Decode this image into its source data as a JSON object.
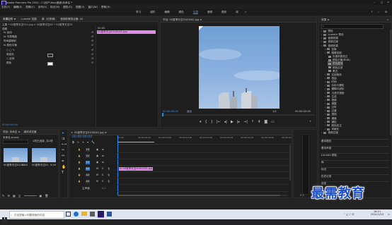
{
  "window": {
    "title": "Adobe Premiere Pro 2020 - C:\\用户\\Hao\\桌面\\未命名 *",
    "menu": [
      "文件(F)",
      "编辑(E)",
      "剪辑(C)",
      "序列(S)",
      "标记(M)",
      "图形(G)",
      "视图(V)",
      "窗口(W)",
      "帮助(H)"
    ]
  },
  "workspaces": {
    "tabs": [
      "学习",
      "组件",
      "编辑",
      "颜色",
      "效果",
      "音频",
      "图形",
      "库"
    ],
    "active_index": 4
  },
  "effect_controls": {
    "tabs": [
      "效果控件 ≡",
      "Lumetri 范围",
      "源: (无剪辑)",
      "音频剪辑混合器: 00"
    ],
    "source_line": "主要 * 00夏季天空011.jpg ∨   00夏季天空01 * 00夏季天空01",
    "video_header": "视频",
    "clip_time": "00:00",
    "clip_name": "00夏季天空0100042.jpg",
    "rows": [
      "fx 运动",
      "fx 不透明度",
      "时间重映射",
      "fx 颜色平衡",
      "○ □ ✎",
      "渐变色",
      "○ 反转",
      "颜色"
    ],
    "timecode": "00:00:00:00"
  },
  "program_monitor": {
    "title": "节目: 00夏季天空0100042.jpg ≡",
    "timecode_left": "00:00:00:00",
    "fit_label": "适合",
    "quality": "1/2",
    "timecode_right": "00:00:02:00"
  },
  "project": {
    "tabs": [
      "项目: 未命名 ≡",
      "媒体浏览器"
    ],
    "file_label": "未命名.prproj",
    "items_count": "1项已选择, 共2项",
    "thumbs": [
      {
        "name": "00夏季天空01002",
        "duration": "5:00"
      },
      {
        "name": "00夏季天空01",
        "duration": "5:00"
      }
    ]
  },
  "timeline": {
    "title": "00夏季天空0100042.jpg ≡",
    "timecode": "00:00:00:00",
    "ruler": [
      "00:00",
      "00:00:05:00",
      "00:00:10:00",
      "00:00:15:00",
      "00:00:20:00",
      "00:00:25:00",
      "00:00:30:00",
      "00:00:35:00",
      "00:00:40:00"
    ],
    "tracks": [
      "V3",
      "V2",
      "V1",
      "A1",
      "A2",
      "A3",
      "主声道"
    ],
    "master_value": "0.0",
    "clip_label": "fx 00夏季天空0100042.jpg"
  },
  "effects_panel": {
    "title": "效果 ≡",
    "items": [
      {
        "label": "预设",
        "level": 0
      },
      {
        "label": "Lumetri 预设",
        "level": 0
      },
      {
        "label": "音频效果",
        "level": 0
      },
      {
        "label": "音频过渡",
        "level": 0
      },
      {
        "label": "视频效果",
        "level": 0
      },
      {
        "label": "变换",
        "level": 1
      },
      {
        "label": "图像控制",
        "level": 1
      },
      {
        "label": "灰度系数校正",
        "level": 2
      },
      {
        "label": "颜色平衡(RGB)",
        "level": 2
      },
      {
        "label": "颜色替换",
        "level": 2
      },
      {
        "label": "颜色过滤",
        "level": 2
      },
      {
        "label": "黑白",
        "level": 2
      },
      {
        "label": "实用程序",
        "level": 1
      },
      {
        "label": "扭曲",
        "level": 1
      },
      {
        "label": "时间",
        "level": 1
      },
      {
        "label": "杂色与颗粒",
        "level": 1
      },
      {
        "label": "模糊与锐化",
        "level": 1
      },
      {
        "label": "沉浸式视频",
        "level": 1
      },
      {
        "label": "生成",
        "level": 1
      },
      {
        "label": "视频",
        "level": 1
      },
      {
        "label": "调整",
        "level": 1
      },
      {
        "label": "过时",
        "level": 1
      },
      {
        "label": "过渡",
        "level": 1
      },
      {
        "label": "透视",
        "level": 1
      },
      {
        "label": "通道",
        "level": 1
      },
      {
        "label": "键控",
        "level": 1
      },
      {
        "label": "颜色校正",
        "level": 1
      },
      {
        "label": "风格化",
        "level": 1
      },
      {
        "label": "视频过渡",
        "level": 0
      }
    ],
    "sections": [
      "基本图形",
      "基本声音",
      "Lumetri 颜色",
      "库",
      "标记",
      "历史记录",
      "信息"
    ],
    "highlight_index": 9
  },
  "watermark": "最需教育",
  "taskbar": {
    "search_placeholder": "在这里输入你要搜索的内容",
    "time": "16:11",
    "date": "2021/1/14"
  },
  "colors": {
    "accent_blue": "#2d8ceb",
    "clip_pink": "#e08fe6",
    "sky_blue": "#7fa6d6"
  }
}
